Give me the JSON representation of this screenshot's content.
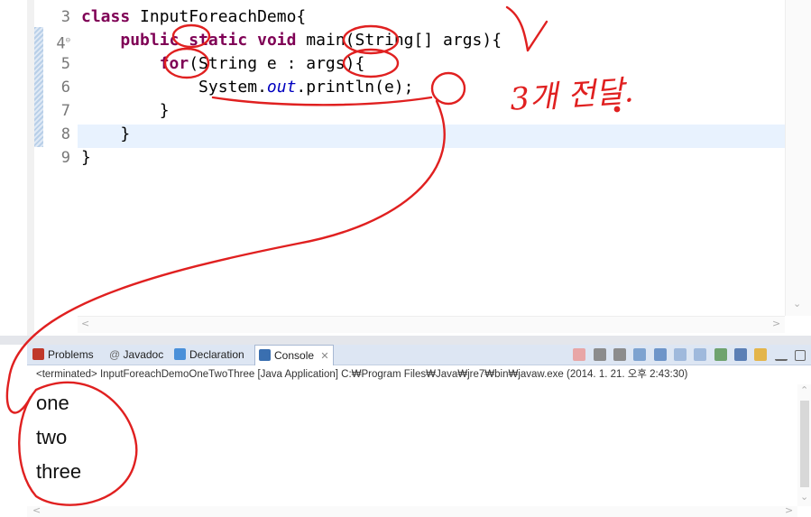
{
  "editor": {
    "lines": [
      {
        "num": "3",
        "fold": "",
        "indent": "",
        "tokens": [
          {
            "t": "kw",
            "v": "class"
          },
          {
            "t": "txt",
            "v": " InputForeachDemo{"
          }
        ]
      },
      {
        "num": "4",
        "fold": "⊖",
        "indent": "    ",
        "tokens": [
          {
            "t": "kw",
            "v": "public"
          },
          {
            "t": "txt",
            "v": " "
          },
          {
            "t": "kw",
            "v": "static"
          },
          {
            "t": "txt",
            "v": " "
          },
          {
            "t": "kw",
            "v": "void"
          },
          {
            "t": "txt",
            "v": " main(String[] args){"
          }
        ]
      },
      {
        "num": "5",
        "fold": "",
        "indent": "        ",
        "tokens": [
          {
            "t": "kw",
            "v": "for"
          },
          {
            "t": "txt",
            "v": "(String e : args){"
          }
        ]
      },
      {
        "num": "6",
        "fold": "",
        "indent": "            ",
        "tokens": [
          {
            "t": "txt",
            "v": "System."
          },
          {
            "t": "fld",
            "v": "out"
          },
          {
            "t": "txt",
            "v": ".println(e);"
          }
        ]
      },
      {
        "num": "7",
        "fold": "",
        "indent": "        ",
        "tokens": [
          {
            "t": "txt",
            "v": "}"
          }
        ]
      },
      {
        "num": "8",
        "fold": "",
        "indent": "    ",
        "tokens": [
          {
            "t": "txt",
            "v": "}"
          }
        ]
      },
      {
        "num": "9",
        "fold": "",
        "indent": "",
        "tokens": [
          {
            "t": "txt",
            "v": "}"
          }
        ]
      }
    ],
    "current_line": "8"
  },
  "views": {
    "tabs": [
      {
        "label": "Problems",
        "icon": "problems-icon",
        "color": "#c0392b"
      },
      {
        "label": "Javadoc",
        "icon": "at-icon",
        "color": "#7a7a7a"
      },
      {
        "label": "Declaration",
        "icon": "declaration-icon",
        "color": "#4a90d9"
      },
      {
        "label": "Console",
        "icon": "console-icon",
        "color": "#3a6fb0"
      }
    ],
    "active_tab": "Console",
    "close_glyph": "✕",
    "console_status": "<terminated> InputForeachDemoOneTwoThree [Java Application] C:₩Program Files₩Java₩jre7₩bin₩javaw.exe (2014. 1. 21. 오후 2:43:30)",
    "console_output": [
      "one",
      "two",
      "three"
    ]
  },
  "annotation": {
    "handwritten_text": "3개 전달.",
    "ink_color": "#e02020"
  }
}
